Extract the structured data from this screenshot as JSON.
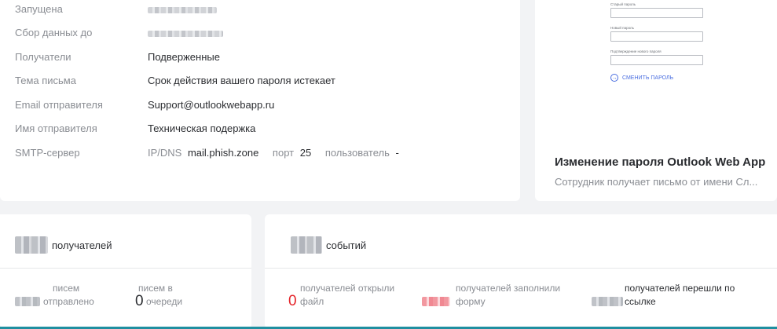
{
  "details": {
    "rows": [
      {
        "label": "Запущена",
        "value": ""
      },
      {
        "label": "Сбор данных до",
        "value": ""
      },
      {
        "label": "Получатели",
        "value": "Подверженные"
      },
      {
        "label": "Тема письма",
        "value": "Срок действия вашего пароля истекает"
      },
      {
        "label": "Email отправителя",
        "value": "Support@outlookwebapp.ru"
      },
      {
        "label": "Имя отправителя",
        "value": "Техническая подержка"
      }
    ],
    "smtp": {
      "label": "SMTP-сервер",
      "ipdns_label": "IP/DNS",
      "host": "mail.phish.zone",
      "port_label": "порт",
      "port": "25",
      "user_label": "пользователь",
      "user": "-"
    }
  },
  "template": {
    "preview": {
      "old_password": "Старый пароль",
      "new_password": "Новый пароль",
      "confirm_password": "Подтверждение нового пароля",
      "change_button": "СМЕНИТЬ ПАРОЛЬ",
      "button_icon": "arrow-right-circle-icon"
    },
    "title": "Изменение пароля Outlook Web App",
    "description": "Сотрудник получает письмо от имени Сл..."
  },
  "recipients": {
    "word": "получателей",
    "stats": [
      {
        "line1": "писем",
        "line2": "отправлено",
        "number": ""
      },
      {
        "line1": "писем в",
        "line2": "очереди",
        "number": "0"
      }
    ]
  },
  "events": {
    "word": "событий",
    "stats": [
      {
        "line1": "получателей открыли",
        "line2": "файл",
        "number": "0"
      },
      {
        "line1": "получателей заполнили",
        "line2": "форму",
        "number": ""
      },
      {
        "line1": "получателей перешли по",
        "line2": "ссылке",
        "number": ""
      }
    ]
  },
  "colors": {
    "accent": "#1f8fa0",
    "alert": "#e5252a",
    "link": "#4a6ee0"
  }
}
